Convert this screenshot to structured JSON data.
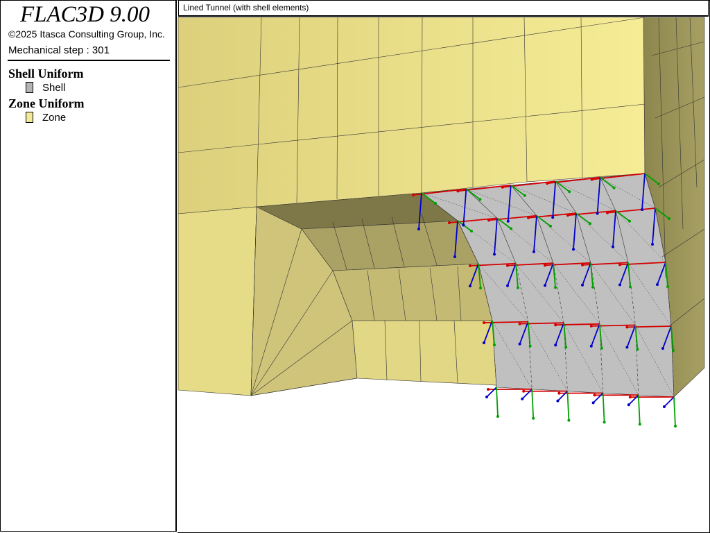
{
  "app": {
    "title": "FLAC3D 9.00",
    "copyright": "©2025 Itasca Consulting Group, Inc.",
    "step": "Mechanical step : 301"
  },
  "legend": {
    "groups": [
      {
        "title": "Shell Uniform",
        "item": {
          "label": "Shell",
          "color": "#b4b4b4"
        }
      },
      {
        "title": "Zone Uniform",
        "item": {
          "label": "Zone",
          "color": "#f2ea9a"
        }
      }
    ]
  },
  "view": {
    "title": "Lined Tunnel (with shell elements)",
    "colors": {
      "zone_front": "#e8de88",
      "zone_side": "#9c955a",
      "zone_dark": "#7a7446",
      "shell": "#c0c0c0",
      "arrow_x": "#d40000",
      "arrow_y": "#00a000",
      "arrow_z": "#0000c8"
    }
  }
}
